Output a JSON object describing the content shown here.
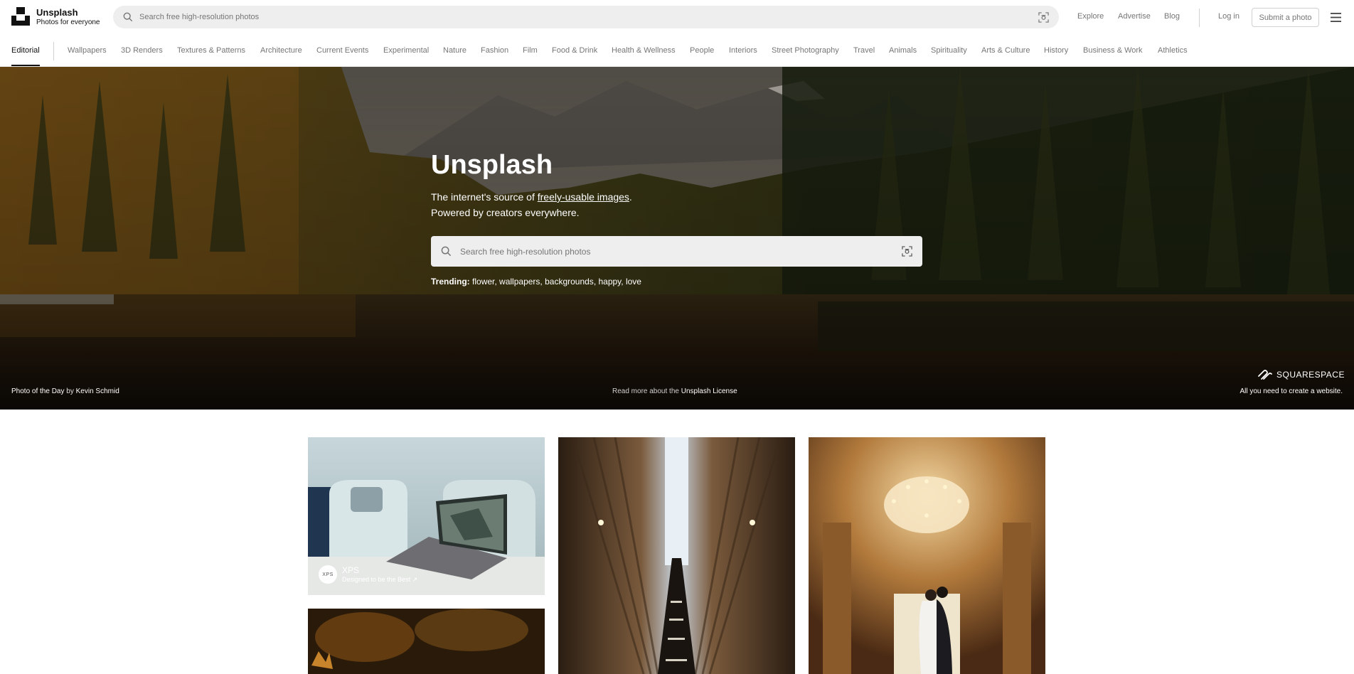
{
  "brand": {
    "name": "Unsplash",
    "tagline": "Photos for everyone"
  },
  "header": {
    "search_placeholder": "Search free high-resolution photos",
    "nav": {
      "explore": "Explore",
      "advertise": "Advertise",
      "blog": "Blog",
      "login": "Log in",
      "submit": "Submit a photo"
    }
  },
  "topics": {
    "active": "Editorial",
    "items": [
      "Wallpapers",
      "3D Renders",
      "Textures & Patterns",
      "Architecture",
      "Current Events",
      "Experimental",
      "Nature",
      "Fashion",
      "Film",
      "Food & Drink",
      "Health & Wellness",
      "People",
      "Interiors",
      "Street Photography",
      "Travel",
      "Animals",
      "Spirituality",
      "Arts & Culture",
      "History",
      "Business & Work",
      "Athletics"
    ]
  },
  "hero": {
    "title": "Unsplash",
    "line1_prefix": "The internet's source of ",
    "line1_link": "freely-usable images",
    "line1_suffix": ".",
    "line2": "Powered by creators everywhere.",
    "search_placeholder": "Search free high-resolution photos",
    "trending_label": "Trending:",
    "trending": [
      "flower",
      "wallpapers",
      "backgrounds",
      "happy",
      "love"
    ],
    "potd_label": "Photo of the Day",
    "potd_by": "by",
    "potd_author": "Kevin Schmid",
    "license_prefix": "Read more about the",
    "license_link": "Unsplash License",
    "sponsor_name": "SQUARESPACE",
    "sponsor_tagline": "All you need to create a website."
  },
  "grid": {
    "sponsored": {
      "avatar": "XPS",
      "name": "XPS",
      "tagline": "Designed to be the Best ↗"
    }
  },
  "icons": {
    "search": "search-icon",
    "visual_search": "visual-search-icon",
    "menu": "menu-icon",
    "logo": "unsplash-logo-icon",
    "squarespace": "squarespace-logo-icon"
  },
  "colors": {
    "text": "#111111",
    "muted": "#767676",
    "search_bg": "#eeeeee",
    "border": "#d1d1d1"
  }
}
